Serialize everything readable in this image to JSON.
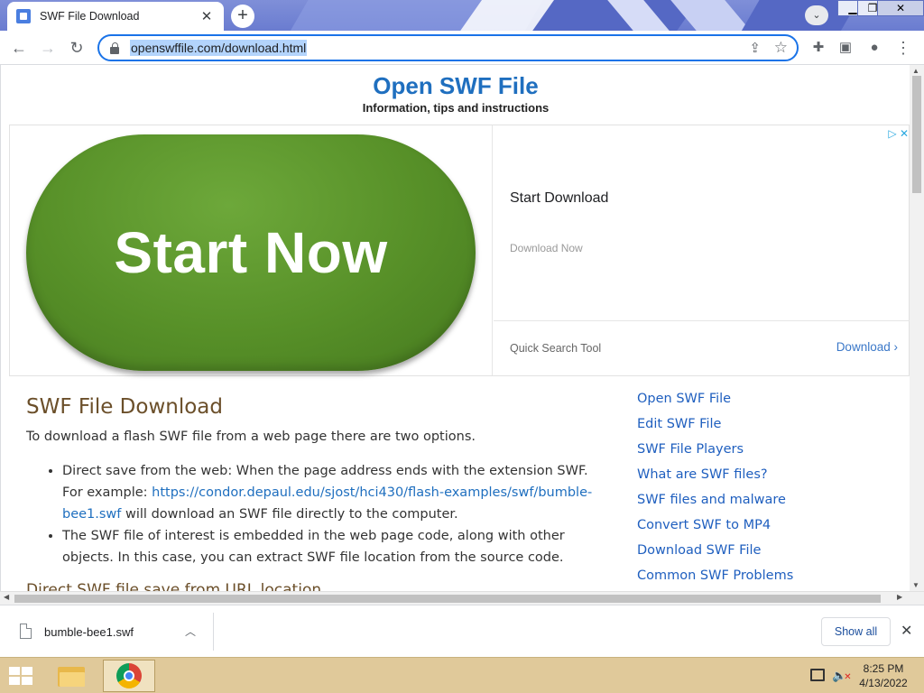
{
  "browser": {
    "tab_title": "SWF File Download",
    "tab_close": "✕",
    "new_tab": "+",
    "url": "openswffile.com/download.html",
    "window_controls": {
      "minimize": "▁",
      "maximize": "❐",
      "close": "✕"
    }
  },
  "site": {
    "title": "Open SWF File",
    "subtitle": "Information, tips and instructions"
  },
  "ad": {
    "button_text": "Start Now",
    "headline": "Start Download",
    "subline": "Download Now",
    "quick_search": "Quick Search Tool",
    "download_link": "Download"
  },
  "article": {
    "heading": "SWF File Download",
    "intro": "To download a flash SWF file from a web page there are two options.",
    "bullet1_pre": "Direct save from the web: When the page address ends with the extension SWF. For example: ",
    "bullet1_link": "https://condor.depaul.edu/sjost/hci430/flash-examples/swf/bumble-bee1.swf",
    "bullet1_post": " will download an SWF file directly to the computer.",
    "bullet2": "The SWF file of interest is embedded in the web page code, along with other objects. In this case, you can extract SWF file location from the source code.",
    "next_heading_partial": "Direct SWF file save from URL location"
  },
  "sidebar": {
    "links": [
      "Open SWF File",
      "Edit SWF File",
      "SWF File Players",
      "What are SWF files?",
      "SWF files and malware",
      "Convert SWF to MP4",
      "Download SWF File",
      "Common SWF Problems"
    ]
  },
  "download_shelf": {
    "filename": "bumble-bee1.swf",
    "show_all": "Show all"
  },
  "taskbar": {
    "time": "8:25 PM",
    "date": "4/13/2022"
  }
}
